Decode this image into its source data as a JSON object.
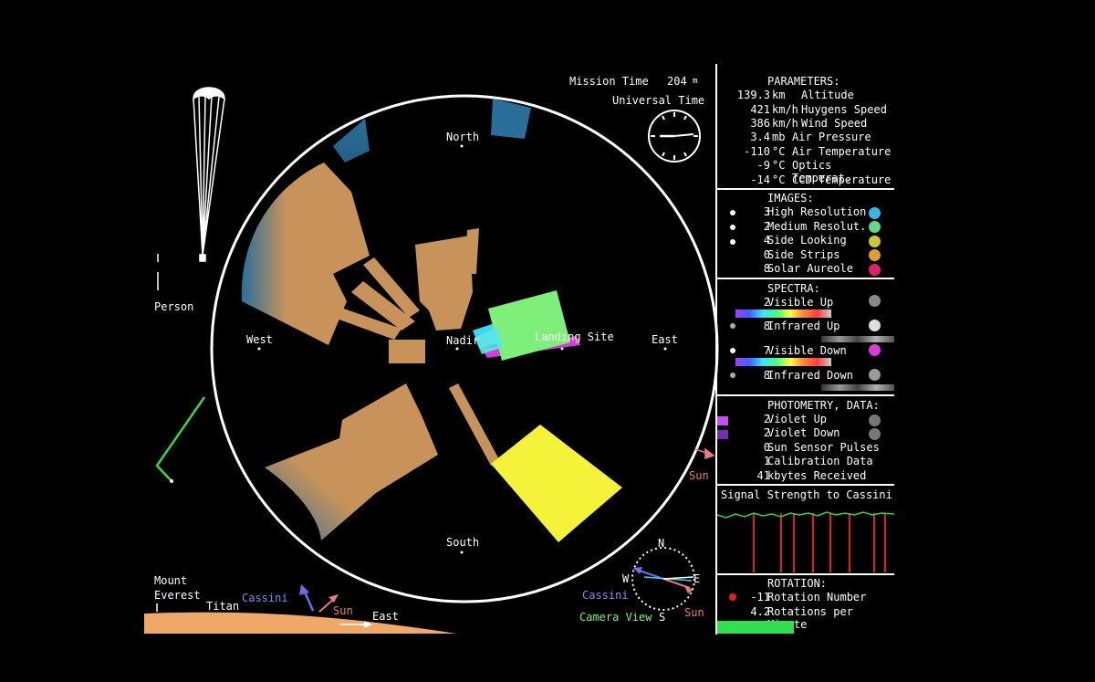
{
  "mission": {
    "time_label": "Mission Time",
    "time_value": "204",
    "time_unit": "m",
    "utc_label": "Universal Time"
  },
  "compass_labels": {
    "north": "North",
    "south": "South",
    "east": "East",
    "west": "West",
    "nadir": "Nadir",
    "landing": "Landing Site"
  },
  "left": {
    "person_label": "Person",
    "sun_label": "Sun"
  },
  "horizon": {
    "everest": "Mount\nEverest",
    "titan": "Titan",
    "cassini": "Cassini",
    "sun": "Sun",
    "east": "East"
  },
  "camera": {
    "cassini": "Cassini",
    "sun": "Sun",
    "view": "Camera View",
    "n": "N",
    "s": "S",
    "e": "E",
    "w": "W"
  },
  "parameters": {
    "title": "PARAMETERS:",
    "rows": [
      {
        "value": "139.3",
        "unit": "km",
        "name": "Altitude"
      },
      {
        "value": "421",
        "unit": "km/h",
        "name": "Huygens Speed"
      },
      {
        "value": "386",
        "unit": "km/h",
        "name": "Wind Speed"
      },
      {
        "value": "3.4",
        "unit": "mb",
        "name": "Air Pressure"
      },
      {
        "value": "-110",
        "unit": "°C",
        "name": "Air Temperature"
      },
      {
        "value": "-9",
        "unit": "°C",
        "name": "Optics Temperat."
      },
      {
        "value": "-14",
        "unit": "°C",
        "name": "CCD Temperature"
      }
    ]
  },
  "images": {
    "title": "IMAGES:",
    "rows": [
      {
        "value": "3",
        "name": "High Resolution",
        "color": "#35b6e6"
      },
      {
        "value": "2",
        "name": "Medium Resolut.",
        "color": "#5cdc8a"
      },
      {
        "value": "4",
        "name": "Side Looking",
        "color": "#c9c838"
      },
      {
        "value": "0",
        "name": "Side Strips",
        "color": "#e0a030"
      },
      {
        "value": "8",
        "name": "Solar Aureole",
        "color": "#e0206a"
      }
    ]
  },
  "spectra": {
    "title": "SPECTRA:",
    "rows": [
      {
        "value": "2",
        "name": "Visible Up"
      },
      {
        "value": "8",
        "name": "Infrared Up"
      },
      {
        "value": "7",
        "name": "Visible Down"
      },
      {
        "value": "8",
        "name": "Infrared Down"
      }
    ]
  },
  "photometry": {
    "title": "PHOTOMETRY, DATA:",
    "rows": [
      {
        "value": "2",
        "name": "Violet Up"
      },
      {
        "value": "2",
        "name": "Violet Down"
      },
      {
        "value": "0",
        "name": "Sun Sensor Pulses"
      },
      {
        "value": "1",
        "name": "Calibration Data"
      },
      {
        "value": "41",
        "name": "kbytes Received"
      }
    ]
  },
  "signal": {
    "title": "Signal Strength to Cassini"
  },
  "rotation": {
    "title": "ROTATION:",
    "rows": [
      {
        "value": "-11",
        "name": "Rotation Number"
      },
      {
        "value": "4.2",
        "name": "Rotations per Minute"
      }
    ]
  },
  "colors": {
    "tan": "#c8935a",
    "blue": "#2a6f9b",
    "yellow": "#f5f23a",
    "green": "#7ef07a",
    "cyan": "#3ad8f0",
    "magenta": "#d83ad8"
  }
}
